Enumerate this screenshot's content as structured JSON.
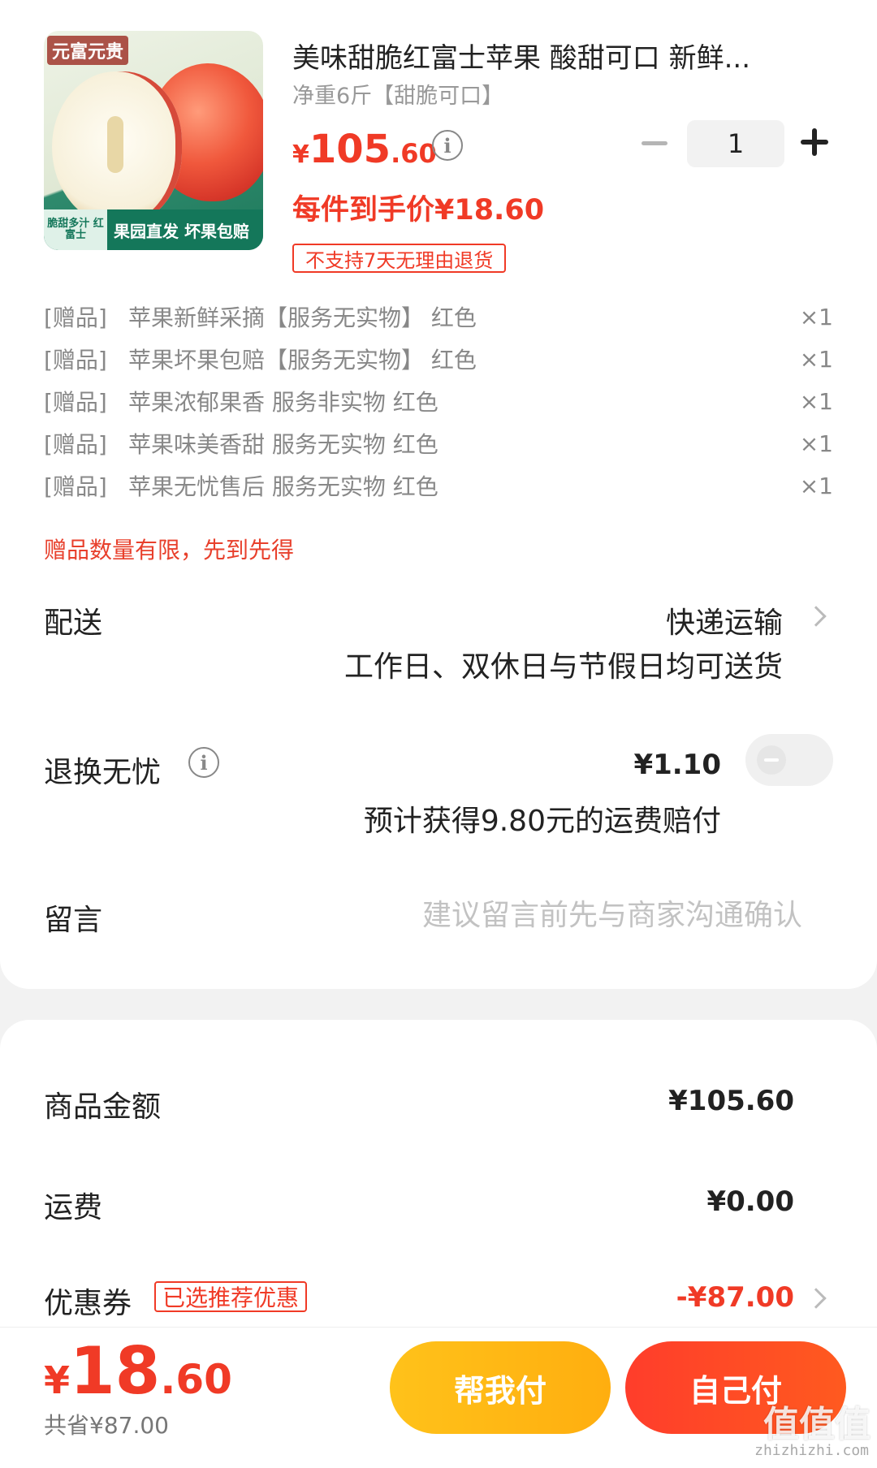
{
  "product": {
    "image_brand": "元富元贵",
    "image_tag": "脆甜多汁 红富士",
    "image_banner": "果园直发 坏果包赔",
    "title": "美味甜脆红富士苹果 酸甜可口 新鲜...",
    "spec": "净重6斤【甜脆可口】",
    "price_currency": "¥",
    "price_int": "105",
    "price_dec": ".60",
    "unit_price": "每件到手价¥18.60",
    "no_return": "不支持7天无理由退货",
    "quantity": "1"
  },
  "gifts": [
    {
      "tag": "[赠品]",
      "name": "苹果新鲜采摘【服务无实物】 红色",
      "qty": "×1"
    },
    {
      "tag": "[赠品]",
      "name": "苹果坏果包赔【服务无实物】 红色",
      "qty": "×1"
    },
    {
      "tag": "[赠品]",
      "name": "苹果浓郁果香 服务非实物 红色",
      "qty": "×1"
    },
    {
      "tag": "[赠品]",
      "name": "苹果味美香甜 服务无实物 红色",
      "qty": "×1"
    },
    {
      "tag": "[赠品]",
      "name": "苹果无忧售后 服务无实物 红色",
      "qty": "×1"
    }
  ],
  "gift_note": "赠品数量有限，先到先得",
  "delivery": {
    "label": "配送",
    "value": "快递运输",
    "sub": "工作日、双休日与节假日均可送货"
  },
  "return_insurance": {
    "label": "退换无忧",
    "price": "¥1.10",
    "sub": "预计获得9.80元的运费赔付",
    "enabled": false
  },
  "message": {
    "label": "留言",
    "placeholder": "建议留言前先与商家沟通确认"
  },
  "summary": {
    "goods_label": "商品金额",
    "goods_value": "¥105.60",
    "shipping_label": "运费",
    "shipping_value": "¥0.00",
    "coupon_label": "优惠券",
    "coupon_badge": "已选推荐优惠",
    "coupon_value": "-¥87.00"
  },
  "bottom": {
    "total_currency": "¥",
    "total_int": "18",
    "total_dec": ".60",
    "saved": "共省¥87.00",
    "help_pay": "帮我付",
    "self_pay": "自己付"
  },
  "watermark": {
    "text": "值值值",
    "site": "zhizhizhi.com"
  },
  "colors": {
    "accent_red": "#f03a26",
    "help_pay_yellow": "#ffb814",
    "self_pay_red": "#ff4a25"
  }
}
